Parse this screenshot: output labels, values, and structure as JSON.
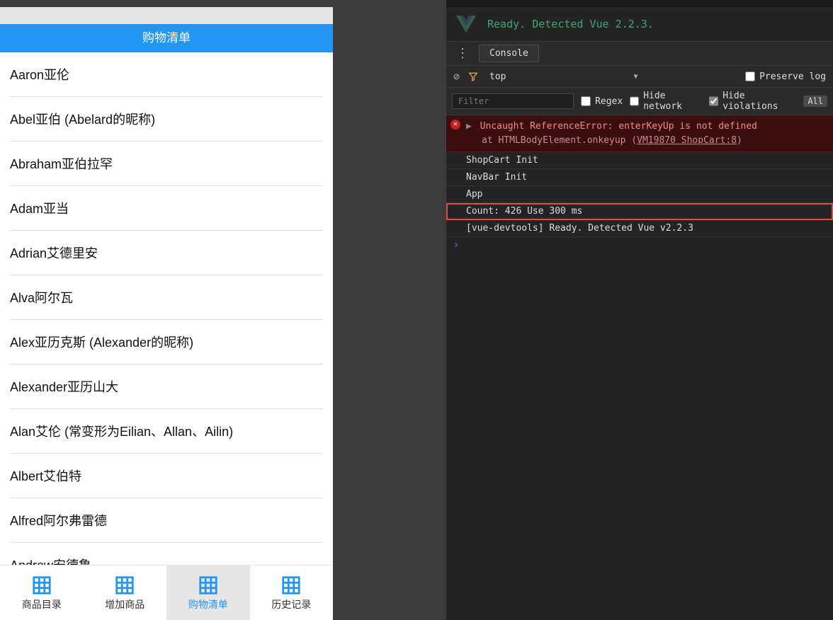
{
  "left": {
    "title": "购物清单",
    "items": [
      "Aaron亚伦",
      "Abel亚伯 (Abelard的昵称)",
      "Abraham亚伯拉罕",
      "Adam亚当",
      "Adrian艾德里安",
      "Alva阿尔瓦",
      "Alex亚历克斯 (Alexander的昵称)",
      "Alexander亚历山大",
      "Alan艾伦 (常变形为Eilian、Allan、Ailin)",
      "Albert艾伯特",
      "Alfred阿尔弗雷德",
      "Andrew安德鲁"
    ],
    "nav": [
      {
        "label": "商品目录",
        "active": false
      },
      {
        "label": "增加商品",
        "active": false
      },
      {
        "label": "购物清单",
        "active": true
      },
      {
        "label": "历史记录",
        "active": false
      }
    ]
  },
  "right": {
    "vue_ready": "Ready. Detected Vue 2.2.3.",
    "tab": "Console",
    "context": "top",
    "preserve_log_label": "Preserve log",
    "preserve_log_checked": false,
    "filter_placeholder": "Filter",
    "regex_label": "Regex",
    "regex_checked": false,
    "hide_network_label": "Hide network",
    "hide_network_checked": false,
    "hide_violations_label": "Hide violations",
    "hide_violations_checked": true,
    "all_pill": "All",
    "error": {
      "line1": "Uncaught ReferenceError: enterKeyUp is not defined",
      "line2_prefix": "at HTMLBodyElement.onkeyup (",
      "line2_src": "VM19870 ShopCart:8",
      "line2_suffix": ")"
    },
    "logs": [
      {
        "text": "ShopCart Init",
        "hl": false
      },
      {
        "text": "NavBar Init",
        "hl": false
      },
      {
        "text": "App",
        "hl": false
      },
      {
        "text": "Count: 426 Use 300 ms",
        "hl": true
      },
      {
        "text": "[vue-devtools] Ready. Detected Vue v2.2.3",
        "hl": false
      }
    ],
    "prompt": "›"
  }
}
